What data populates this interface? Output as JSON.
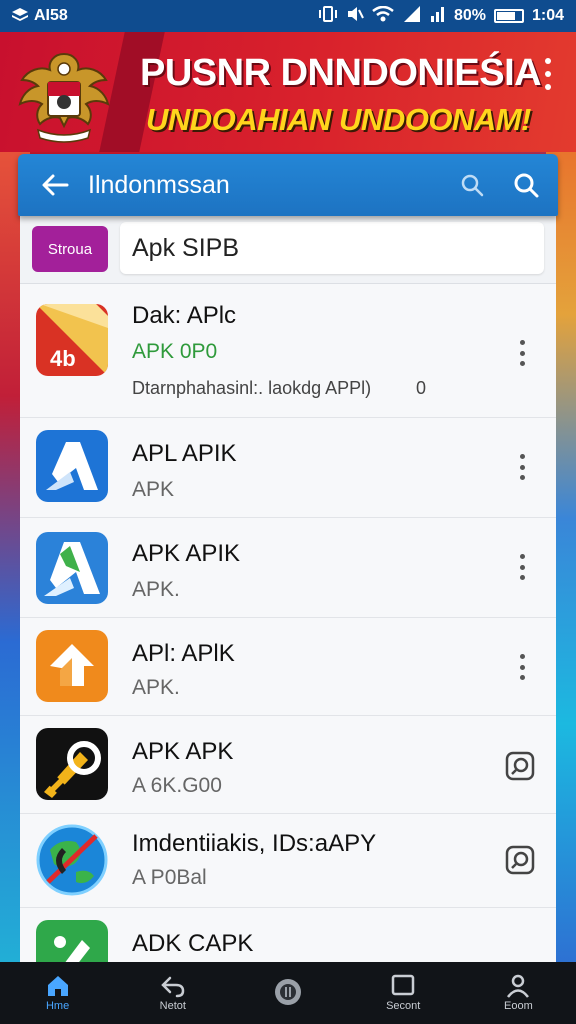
{
  "status_bar": {
    "left_text": "AI58",
    "battery_text": "80%",
    "time": "1:04"
  },
  "banner": {
    "title": "PUSNR DNNDONIEŚIA",
    "subtitle": "UNDOAHIAN UNDOONAM!"
  },
  "app_bar": {
    "title": "Ilndonmssan"
  },
  "tag_row": {
    "chip_label": "Stroua",
    "field_text": "Apk SIPB"
  },
  "apps": [
    {
      "name": "Dak: APlc",
      "sub": "APK 0P0",
      "desc": "Dtarnphahasinl:. laokdg APPl)",
      "desc_extra": "0",
      "action": "menu"
    },
    {
      "name": "APL APIK",
      "sub": "APK",
      "action": "menu"
    },
    {
      "name": "APK APIK",
      "sub": "APK.",
      "action": "menu"
    },
    {
      "name": "APl: APlK",
      "sub": "APK.",
      "action": "menu"
    },
    {
      "name": "APK APK",
      "sub": "A 6K.G00",
      "action": "open"
    },
    {
      "name": "Imdentiiakis, IDs:aAPY",
      "sub": "A P0Bal",
      "action": "open"
    },
    {
      "name": "ADK CAPK",
      "sub": "",
      "action": "none"
    }
  ],
  "bottom_nav": [
    {
      "label": "Hme",
      "icon": "home-icon",
      "active": true
    },
    {
      "label": "Netot",
      "icon": "back-arrow-icon",
      "active": false
    },
    {
      "label": "",
      "icon": "circle-button-icon",
      "active": false
    },
    {
      "label": "Secont",
      "icon": "square-icon",
      "active": false
    },
    {
      "label": "Eoom",
      "icon": "person-icon",
      "active": false
    }
  ],
  "colors": {
    "status_bar": "#0f4c8f",
    "banner_red": "#d9222c",
    "banner_yellow": "#ffd51d",
    "app_bar_blue": "#1d73c2",
    "tag_purple": "#a3209a",
    "sub_green": "#2f9a3b",
    "nav_active": "#49a6ff"
  }
}
